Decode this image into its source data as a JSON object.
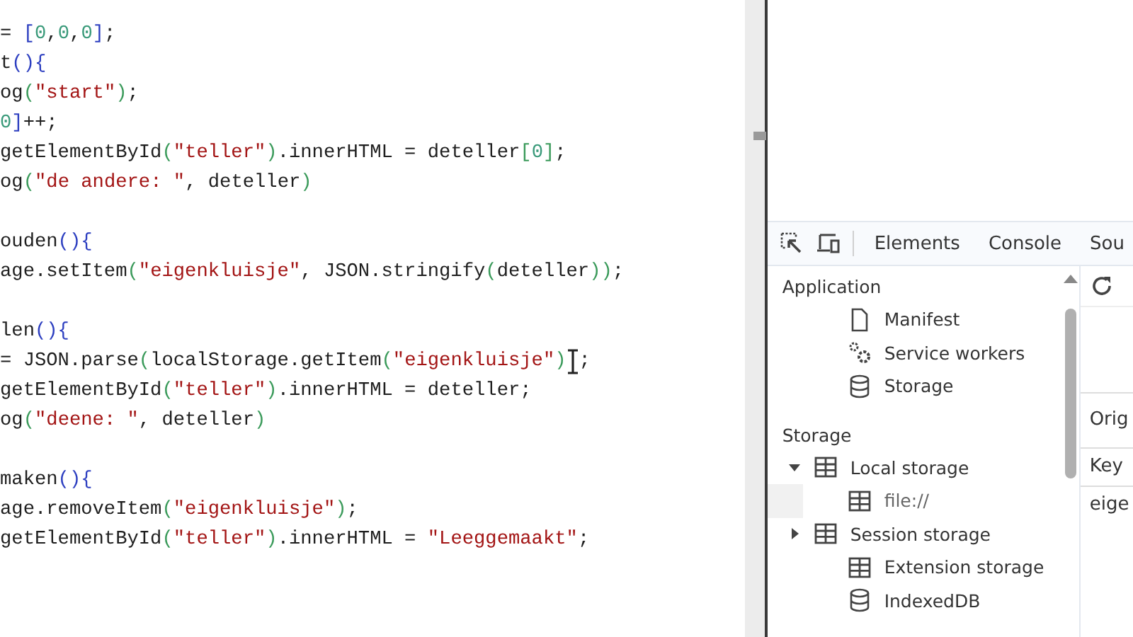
{
  "editor": {
    "lines": [
      {
        "kind": "code",
        "tokens": [
          {
            "kind": "plain",
            "text": "= "
          },
          {
            "kind": "bracket",
            "text": "["
          },
          {
            "kind": "number",
            "text": "0"
          },
          {
            "kind": "plain",
            "text": ","
          },
          {
            "kind": "number",
            "text": "0"
          },
          {
            "kind": "plain",
            "text": ","
          },
          {
            "kind": "number",
            "text": "0"
          },
          {
            "kind": "bracket",
            "text": "]"
          },
          {
            "kind": "plain",
            "text": ";"
          }
        ]
      },
      {
        "kind": "code",
        "tokens": [
          {
            "kind": "plain",
            "text": "t"
          },
          {
            "kind": "bracket",
            "text": "(){"
          }
        ]
      },
      {
        "kind": "code",
        "tokens": [
          {
            "kind": "plain",
            "text": "og"
          },
          {
            "kind": "paren",
            "text": "("
          },
          {
            "kind": "string",
            "text": "\"start\""
          },
          {
            "kind": "paren",
            "text": ")"
          },
          {
            "kind": "plain",
            "text": ";"
          }
        ]
      },
      {
        "kind": "code",
        "tokens": [
          {
            "kind": "number",
            "text": "0"
          },
          {
            "kind": "bracket",
            "text": "]"
          },
          {
            "kind": "plain",
            "text": "++;"
          }
        ]
      },
      {
        "kind": "code",
        "tokens": [
          {
            "kind": "plain",
            "text": "getElementById"
          },
          {
            "kind": "paren",
            "text": "("
          },
          {
            "kind": "string",
            "text": "\"teller\""
          },
          {
            "kind": "paren",
            "text": ")"
          },
          {
            "kind": "plain",
            "text": ".innerHTML = deteller"
          },
          {
            "kind": "paren",
            "text": "["
          },
          {
            "kind": "number",
            "text": "0"
          },
          {
            "kind": "paren",
            "text": "]"
          },
          {
            "kind": "plain",
            "text": ";"
          }
        ]
      },
      {
        "kind": "code",
        "tokens": [
          {
            "kind": "plain",
            "text": "og"
          },
          {
            "kind": "paren",
            "text": "("
          },
          {
            "kind": "string",
            "text": "\"de andere: \""
          },
          {
            "kind": "plain",
            "text": ", deteller"
          },
          {
            "kind": "paren",
            "text": ")"
          }
        ]
      },
      {
        "kind": "blank"
      },
      {
        "kind": "code",
        "tokens": [
          {
            "kind": "plain",
            "text": "ouden"
          },
          {
            "kind": "bracket",
            "text": "(){"
          }
        ]
      },
      {
        "kind": "code",
        "tokens": [
          {
            "kind": "plain",
            "text": "age.setItem"
          },
          {
            "kind": "paren",
            "text": "("
          },
          {
            "kind": "string",
            "text": "\"eigenkluisje\""
          },
          {
            "kind": "plain",
            "text": ", JSON.stringify"
          },
          {
            "kind": "paren",
            "text": "("
          },
          {
            "kind": "plain",
            "text": "deteller"
          },
          {
            "kind": "paren",
            "text": "))"
          },
          {
            "kind": "plain",
            "text": ";"
          }
        ]
      },
      {
        "kind": "blank"
      },
      {
        "kind": "code",
        "tokens": [
          {
            "kind": "plain",
            "text": "len"
          },
          {
            "kind": "bracket",
            "text": "(){"
          }
        ]
      },
      {
        "kind": "code",
        "tokens": [
          {
            "kind": "plain",
            "text": "= JSON.parse"
          },
          {
            "kind": "paren",
            "text": "("
          },
          {
            "kind": "plain",
            "text": "localStorage.getItem"
          },
          {
            "kind": "paren",
            "text": "("
          },
          {
            "kind": "string",
            "text": "\"eigenkluisje\""
          },
          {
            "kind": "paren",
            "text": ")"
          },
          {
            "kind": "cursor"
          },
          {
            "kind": "plain",
            "text": ";"
          }
        ]
      },
      {
        "kind": "code",
        "tokens": [
          {
            "kind": "plain",
            "text": "getElementById"
          },
          {
            "kind": "paren",
            "text": "("
          },
          {
            "kind": "string",
            "text": "\"teller\""
          },
          {
            "kind": "paren",
            "text": ")"
          },
          {
            "kind": "plain",
            "text": ".innerHTML = deteller;"
          }
        ]
      },
      {
        "kind": "code",
        "tokens": [
          {
            "kind": "plain",
            "text": "og"
          },
          {
            "kind": "paren",
            "text": "("
          },
          {
            "kind": "string",
            "text": "\"deene: \""
          },
          {
            "kind": "plain",
            "text": ", deteller"
          },
          {
            "kind": "paren",
            "text": ")"
          }
        ]
      },
      {
        "kind": "blank"
      },
      {
        "kind": "code",
        "tokens": [
          {
            "kind": "plain",
            "text": "maken"
          },
          {
            "kind": "bracket",
            "text": "(){"
          }
        ]
      },
      {
        "kind": "code",
        "tokens": [
          {
            "kind": "plain",
            "text": "age.removeItem"
          },
          {
            "kind": "paren",
            "text": "("
          },
          {
            "kind": "string",
            "text": "\"eigenkluisje\""
          },
          {
            "kind": "paren",
            "text": ")"
          },
          {
            "kind": "plain",
            "text": ";"
          }
        ]
      },
      {
        "kind": "code",
        "tokens": [
          {
            "kind": "plain",
            "text": "getElementById"
          },
          {
            "kind": "paren",
            "text": "("
          },
          {
            "kind": "string",
            "text": "\"teller\""
          },
          {
            "kind": "paren",
            "text": ")"
          },
          {
            "kind": "plain",
            "text": ".innerHTML = "
          },
          {
            "kind": "string",
            "text": "\"Leeggemaakt\""
          },
          {
            "kind": "plain",
            "text": ";"
          }
        ]
      }
    ]
  },
  "devtools": {
    "tabs": [
      {
        "label": "Elements",
        "selected": false
      },
      {
        "label": "Console",
        "selected": false
      },
      {
        "label": "Sou",
        "selected": false
      }
    ],
    "sidebar": {
      "sections": [
        {
          "title": "Application",
          "items": [
            {
              "label": "Manifest",
              "kind": "document"
            },
            {
              "label": "Service workers",
              "kind": "gears"
            },
            {
              "label": "Storage",
              "kind": "database"
            }
          ]
        },
        {
          "title": "Storage",
          "items": [
            {
              "label": "Local storage",
              "kind": "table",
              "expanded": true,
              "children": [
                {
                  "label": "file://",
                  "kind": "table",
                  "selected": true
                }
              ]
            },
            {
              "label": "Session storage",
              "kind": "table",
              "expanded": false
            },
            {
              "label": "Extension storage",
              "kind": "table"
            },
            {
              "label": "IndexedDB",
              "kind": "database"
            }
          ]
        }
      ]
    },
    "main": {
      "origin_label": "Orig",
      "column_1": "Key",
      "row_1": "eige"
    }
  }
}
